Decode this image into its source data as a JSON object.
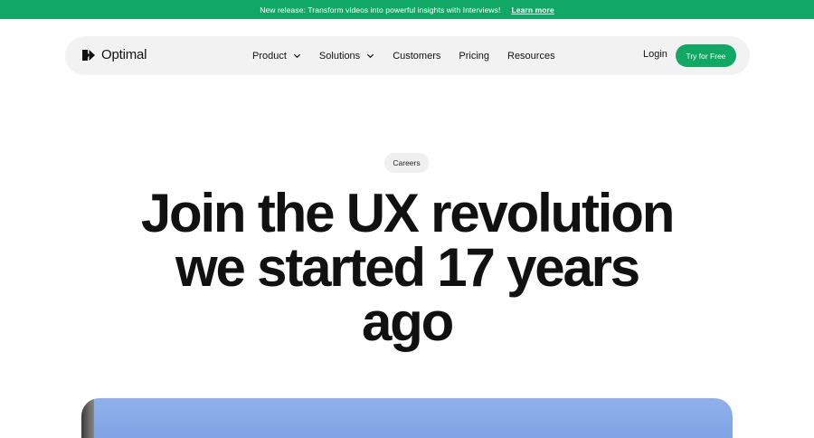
{
  "announcement": {
    "message": "New release: Transform videos into powerful insights with Interviews!",
    "link_label": "Learn more"
  },
  "nav": {
    "brand": "Optimal",
    "items": [
      {
        "label": "Product",
        "has_dropdown": true
      },
      {
        "label": "Solutions",
        "has_dropdown": true
      },
      {
        "label": "Customers",
        "has_dropdown": false
      },
      {
        "label": "Pricing",
        "has_dropdown": false
      },
      {
        "label": "Resources",
        "has_dropdown": false
      }
    ],
    "login_label": "Login",
    "cta_label": "Try for Free"
  },
  "hero": {
    "tag": "Careers",
    "headline_lines": [
      "Join the UX revolution",
      "we started 17 years",
      "ago"
    ]
  },
  "colors": {
    "brand_green": "#11a865",
    "nav_bg": "#f2f2f2",
    "text": "#111111"
  },
  "icons": {
    "logo": "optimal-logo-icon",
    "dropdown": "chevron-down-icon"
  }
}
